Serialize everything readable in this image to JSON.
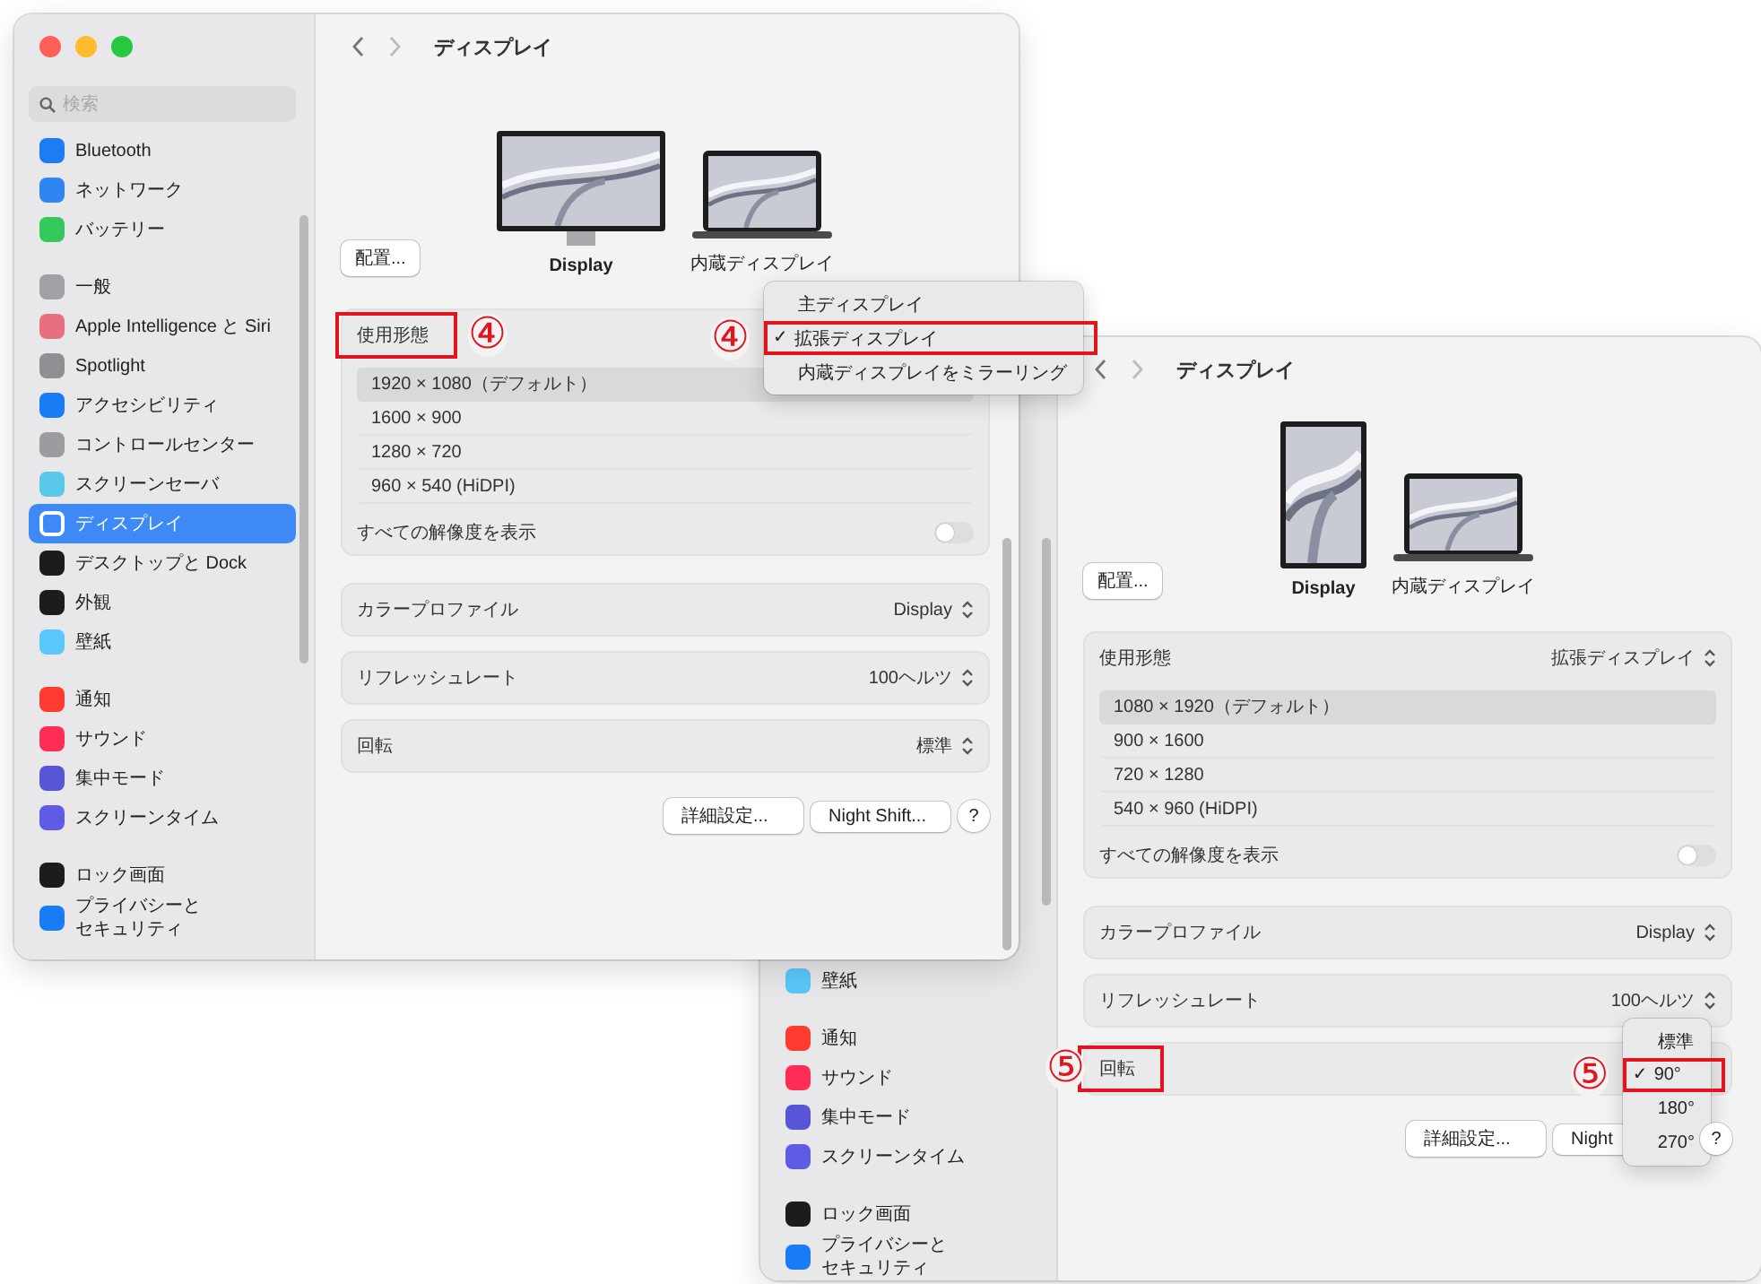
{
  "windows": [
    {
      "traffic_lights": true,
      "sidebar": {
        "search": {
          "placeholder": "検索"
        },
        "groups": [
          [
            {
              "label": "Bluetooth",
              "color": "#1e7bf2",
              "selected": false
            },
            {
              "label": "ネットワーク",
              "color": "#2f86f0",
              "selected": false
            },
            {
              "label": "バッテリー",
              "color": "#34c759",
              "selected": false
            }
          ],
          [
            {
              "label": "一般",
              "color": "#a0a0a6",
              "selected": false
            },
            {
              "label": "Apple Intelligence と Siri",
              "color": "#e8707e",
              "selected": false
            },
            {
              "label": "Spotlight",
              "color": "#8e8e93",
              "selected": false
            },
            {
              "label": "アクセシビリティ",
              "color": "#1a7cf5",
              "selected": false
            },
            {
              "label": "コントロールセンター",
              "color": "#9b9ba0",
              "selected": false
            },
            {
              "label": "スクリーンセーバ",
              "color": "#5ac8e8",
              "selected": false
            },
            {
              "label": "ディスプレイ",
              "color": "#3d8af7",
              "selected": true
            },
            {
              "label": "デスクトップと Dock",
              "color": "#1c1c1e",
              "selected": false
            },
            {
              "label": "外観",
              "color": "#1c1c1e",
              "selected": false
            },
            {
              "label": "壁紙",
              "color": "#5ac8fa",
              "selected": false
            }
          ],
          [
            {
              "label": "通知",
              "color": "#ff3b30",
              "selected": false
            },
            {
              "label": "サウンド",
              "color": "#ff2d55",
              "selected": false
            },
            {
              "label": "集中モード",
              "color": "#5856d6",
              "selected": false
            },
            {
              "label": "スクリーンタイム",
              "color": "#5e5ce6",
              "selected": false
            }
          ],
          [
            {
              "label": "ロック画面",
              "color": "#1c1c1e",
              "selected": false
            },
            {
              "lines": [
                "プライバシーと",
                "セキュリティ"
              ],
              "color": "#1a7cf5",
              "selected": false
            }
          ]
        ]
      },
      "content": {
        "title": "ディスプレイ",
        "arrange_button": "配置...",
        "displays": [
          {
            "label": "Display",
            "kind": "monitor",
            "selected": true
          },
          {
            "label": "内蔵ディスプレイ",
            "kind": "laptop",
            "selected": false
          }
        ],
        "mode_row": {
          "label": "使用形態",
          "marked": true,
          "callout": "④",
          "menu": {
            "callout": "④",
            "check_mark": "✓",
            "items": [
              {
                "label": "主ディスプレイ",
                "checked": false
              },
              {
                "label": "拡張ディスプレイ",
                "checked": true,
                "marked": true
              },
              {
                "label": "内蔵ディスプレイをミラーリング",
                "checked": false
              }
            ]
          }
        },
        "resolutions": [
          {
            "label": "1920 × 1080（デフォルト）",
            "selected": true
          },
          {
            "label": "1600 × 900",
            "selected": false
          },
          {
            "label": "1280 × 720",
            "selected": false
          },
          {
            "label": "960 × 540 (HiDPI)",
            "selected": false
          }
        ],
        "show_all": {
          "label": "すべての解像度を表示",
          "on": false
        },
        "settings": [
          {
            "label": "カラープロファイル",
            "value": "Display"
          },
          {
            "label": "リフレッシュレート",
            "value": "100ヘルツ"
          },
          {
            "label": "回転",
            "value": "標準"
          }
        ],
        "buttons": [
          "詳細設定...",
          "Night Shift..."
        ],
        "help": "?"
      }
    },
    {
      "sidebar": {
        "groups": [
          [
            {
              "label": "壁紙",
              "color": "#5ac8fa",
              "selected": false
            }
          ],
          [
            {
              "label": "通知",
              "color": "#ff3b30",
              "selected": false
            },
            {
              "label": "サウンド",
              "color": "#ff2d55",
              "selected": false
            },
            {
              "label": "集中モード",
              "color": "#5856d6",
              "selected": false
            },
            {
              "label": "スクリーンタイム",
              "color": "#5e5ce6",
              "selected": false
            }
          ],
          [
            {
              "label": "ロック画面",
              "color": "#1c1c1e",
              "selected": false
            },
            {
              "lines": [
                "プライバシーと",
                "セキュリティ"
              ],
              "color": "#1a7cf5",
              "selected": false
            }
          ]
        ]
      },
      "content": {
        "title": "ディスプレイ",
        "arrange_button": "配置...",
        "displays": [
          {
            "label": "Display",
            "kind": "portrait_monitor",
            "selected": true
          },
          {
            "label": "内蔵ディスプレイ",
            "kind": "laptop",
            "selected": false
          }
        ],
        "mode_row": {
          "label": "使用形態",
          "value": "拡張ディスプレイ"
        },
        "resolutions": [
          {
            "label": "1080 × 1920（デフォルト）",
            "selected": true
          },
          {
            "label": "900 × 1600",
            "selected": false
          },
          {
            "label": "720 × 1280",
            "selected": false
          },
          {
            "label": "540 × 960 (HiDPI)",
            "selected": false
          }
        ],
        "show_all": {
          "label": "すべての解像度を表示",
          "on": false
        },
        "settings": [
          {
            "label": "カラープロファイル",
            "value": "Display"
          },
          {
            "label": "リフレッシュレート",
            "value": "100ヘルツ"
          },
          {
            "label": "回転",
            "marked": true,
            "callout": "⑤",
            "menu": {
              "callout": "⑤",
              "check_mark": "✓",
              "items": [
                {
                  "label": "標準",
                  "checked": false
                },
                {
                  "label": "90°",
                  "checked": true,
                  "marked": true
                },
                {
                  "label": "180°",
                  "checked": false
                },
                {
                  "label": "270°",
                  "checked": false
                }
              ]
            }
          }
        ],
        "buttons": [
          "詳細設定...",
          "Night"
        ],
        "help": "?"
      }
    }
  ]
}
